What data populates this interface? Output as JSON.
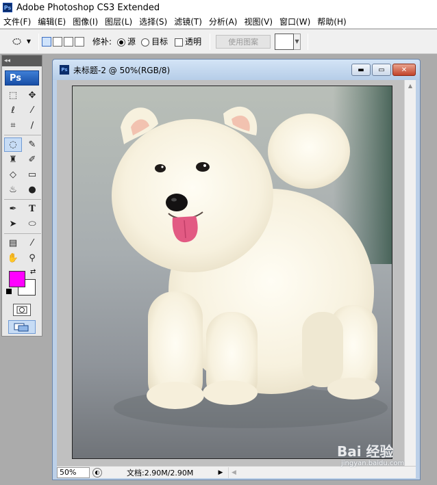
{
  "app": {
    "title": "Adobe Photoshop CS3 Extended",
    "logo_text": "Ps"
  },
  "menu": [
    "文件(F)",
    "编辑(E)",
    "图像(I)",
    "图层(L)",
    "选择(S)",
    "滤镜(T)",
    "分析(A)",
    "视图(V)",
    "窗口(W)",
    "帮助(H)"
  ],
  "options": {
    "patch_label": "修补:",
    "source_label": "源",
    "destination_label": "目标",
    "transparent_label": "透明",
    "use_pattern_label": "使用图案",
    "patch_mode": "源"
  },
  "toolbox": {
    "logo": "Ps",
    "foreground_color": "#ff00ff",
    "background_color": "#ffffff",
    "tools": [
      "marquee-icon",
      "move-icon",
      "lasso-icon",
      "magic-wand-icon",
      "crop-icon",
      "slice-icon",
      "patch-icon",
      "brush-icon",
      "clone-stamp-icon",
      "history-brush-icon",
      "eraser-icon",
      "gradient-icon",
      "blur-icon",
      "dodge-icon",
      "pen-icon",
      "type-icon",
      "path-select-icon",
      "ellipse-icon",
      "notes-icon",
      "eyedropper-icon",
      "hand-icon",
      "zoom-icon"
    ],
    "selected_tool": "patch-icon"
  },
  "document": {
    "title": "未标题-2 @ 50%(RGB/8)",
    "zoom": "50%",
    "doc_info": "文档:2.90M/2.90M"
  },
  "watermark": {
    "text": "Bai 经验",
    "sub": "jingyan.baidu.com"
  }
}
